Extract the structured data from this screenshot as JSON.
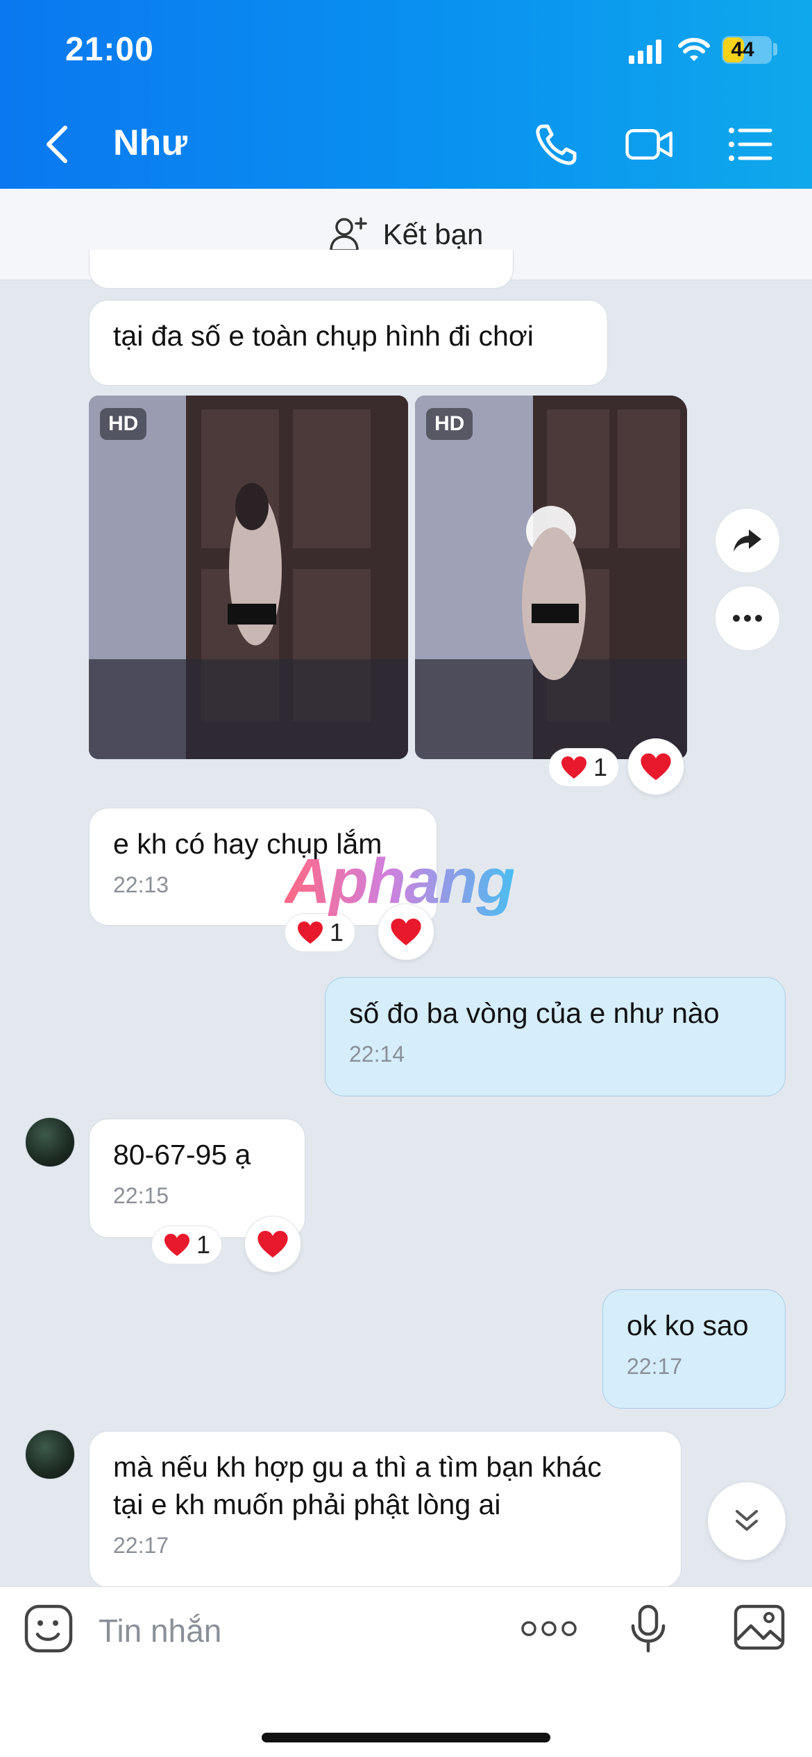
{
  "status": {
    "time": "21:00",
    "battery": "44",
    "battery_level": 0.44
  },
  "header": {
    "name": "Như"
  },
  "friend_bar": {
    "label": "Kết bạn"
  },
  "photos": {
    "badge": "HD"
  },
  "watermark": "Aphang",
  "messages": [
    {
      "text": "tại đa số e toàn chụp hình đi chơi"
    },
    {
      "text": "e kh có hay chụp lắm",
      "time": "22:13",
      "reaction_count": "1"
    },
    {
      "text": "số đo ba vòng của e như nào",
      "time": "22:14"
    },
    {
      "text": "80-67-95 ạ",
      "time": "22:15",
      "reaction_count": "1"
    },
    {
      "text": "ok ko sao",
      "time": "22:17"
    },
    {
      "text": "mà nếu kh hợp gu a thì a tìm bạn khác\ntại e kh muốn phải phật lòng ai",
      "time": "22:17"
    }
  ],
  "photo_reaction_count": "1",
  "input": {
    "placeholder": "Tin nhắn"
  },
  "icons": {
    "back": "chevron-left-icon",
    "call": "phone-icon",
    "video": "video-icon",
    "menu": "list-icon",
    "add_friend": "person-add-icon",
    "forward": "share-icon",
    "more": "more-icon",
    "heart": "heart-icon",
    "scroll": "chevron-double-down-icon",
    "sticker": "sticker-icon",
    "options": "more-dots-icon",
    "mic": "mic-icon",
    "gallery": "image-icon"
  },
  "colors": {
    "header": "#0a78f0",
    "me_bubble": "#d6edfb",
    "heart": "#e8192c",
    "battery": "#f7d21b"
  }
}
